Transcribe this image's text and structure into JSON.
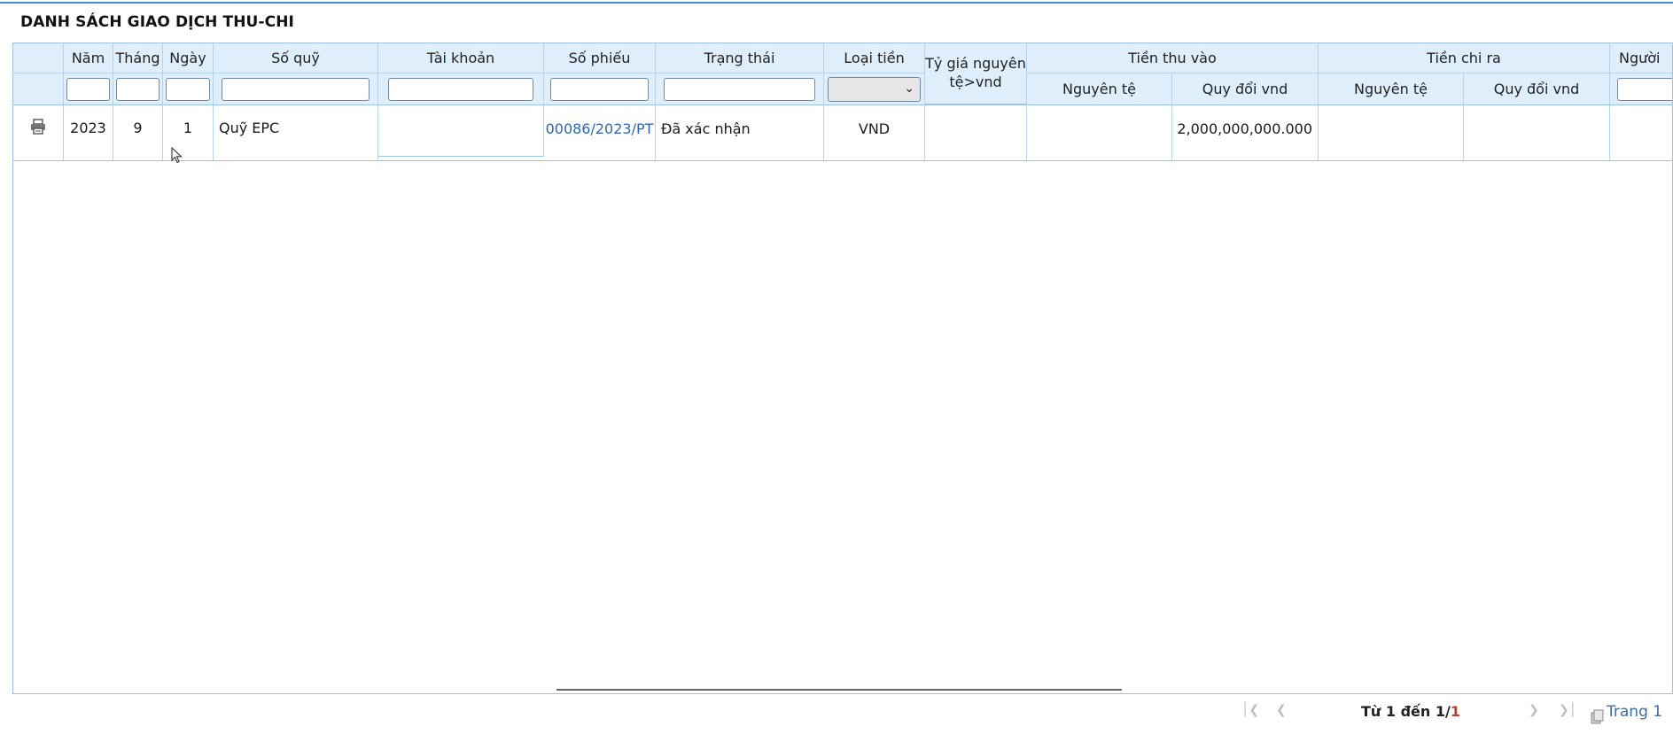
{
  "title": "DANH SÁCH GIAO DỊCH THU-CHI",
  "columns": {
    "nam": "Năm",
    "thang": "Tháng",
    "ngay": "Ngày",
    "so_quy": "Số quỹ",
    "tai_khoan": "Tài khoản",
    "so_phieu": "Số phiếu",
    "trang_thai": "Trạng thái",
    "loai_tien": "Loại tiền",
    "ty_gia": "Tỷ giá nguyên tệ>vnd",
    "tien_thu_vao": "Tiền thu vào",
    "tien_chi_ra": "Tiền chi ra",
    "nguyen_te": "Nguyên tệ",
    "quy_doi_vnd": "Quy đổi vnd",
    "nguoi": "Người"
  },
  "filters": {
    "nam": "",
    "thang": "",
    "ngay": "",
    "so_quy": "",
    "tai_khoan": "",
    "so_phieu": "",
    "trang_thai": "",
    "loai_tien": "",
    "nguoi": ""
  },
  "rows": [
    {
      "icon": "printer-icon",
      "nam": "2023",
      "thang": "9",
      "ngay": "1",
      "so_quy": "Quỹ EPC",
      "tai_khoan": "",
      "so_phieu": "00086/2023/PT",
      "trang_thai": "Đã xác nhận",
      "loai_tien": "VND",
      "ty_gia": "",
      "thu_nguyen_te": "",
      "thu_quy_doi": "2,000,000,000.000",
      "chi_nguyen_te": "",
      "chi_quy_doi": "",
      "nguoi": ""
    }
  ],
  "pager": {
    "first_icon": "first-page-icon",
    "prev_icon": "prev-page-icon",
    "info_prefix": "Từ 1 đến 1/",
    "info_total": "1",
    "next_icon": "next-page-icon",
    "last_icon": "last-page-icon",
    "page_icon": "copy-icon",
    "page_label": "Trang 1"
  },
  "colors": {
    "header_bg": "#dfeefb",
    "border": "#9cc3e3",
    "link": "#2e67b1",
    "accent_line": "#3b8fd6"
  }
}
